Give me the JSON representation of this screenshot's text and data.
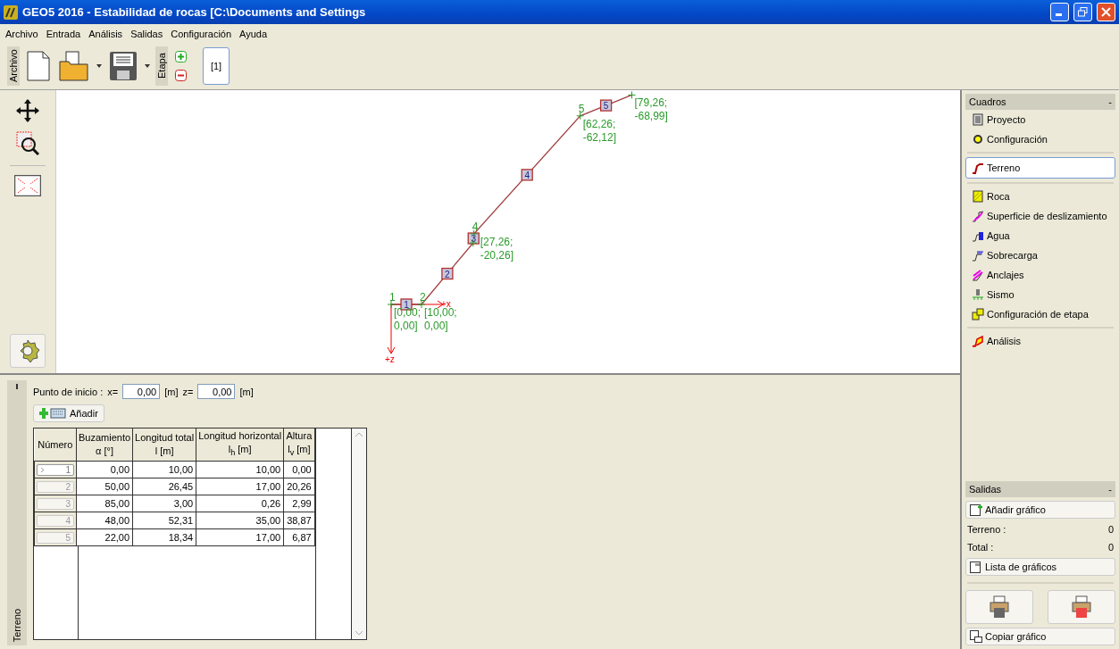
{
  "window": {
    "title": "GEO5 2016 - Estabilidad de rocas [C:\\Documents and Settings"
  },
  "menu": [
    "Archivo",
    "Entrada",
    "Análisis",
    "Salidas",
    "Configuración",
    "Ayuda"
  ],
  "toolbar": {
    "group_label": "Archivo",
    "stage_label": "Etapa",
    "stages": [
      {
        "label": "[1]",
        "selected": true
      }
    ]
  },
  "canvas": {
    "axis_x": "+x",
    "axis_z": "+z",
    "segments": [
      {
        "label": "1"
      },
      {
        "label": "2"
      },
      {
        "label": "3"
      },
      {
        "label": "4"
      },
      {
        "label": "5"
      }
    ],
    "points": [
      {
        "kind": "labelled",
        "number": "1",
        "coords": [
          "[0,00;",
          "0,00]"
        ]
      },
      {
        "kind": "labelled",
        "number": "2",
        "coords": [
          "[10,00;",
          "0,00]"
        ]
      },
      {
        "kind": "bare"
      },
      {
        "kind": "labelled",
        "number": "4",
        "coords": [
          "[27,26;",
          "-20,26]"
        ]
      },
      {
        "kind": "labelled",
        "number": "5",
        "coords": [
          "[62,26;",
          "-62,12]"
        ]
      },
      {
        "kind": "labelled",
        "coords": [
          "[79,26;",
          "-68,99]"
        ]
      }
    ]
  },
  "input": {
    "label": "Punto de inicio :",
    "x_label": "x=",
    "x_value": "0,00",
    "x_unit": "[m]",
    "z_label": "z=",
    "z_value": "0,00",
    "z_unit": "[m]",
    "add_button": "Añadir",
    "tab_label": "Terreno"
  },
  "table": {
    "columns": [
      {
        "title": "Número"
      },
      {
        "title": "Buzamiento",
        "unit": "α [°]"
      },
      {
        "title": "Longitud total",
        "unit": "l [m]"
      },
      {
        "title": "Longitud horizontal",
        "unit": "l$_{h}$ [m]"
      },
      {
        "title": "Altura",
        "unit": "l$_{v}$ [m]"
      }
    ],
    "rows": [
      {
        "selected": true,
        "cells": [
          "1",
          "0,00",
          "10,00",
          "10,00",
          "0,00"
        ]
      },
      {
        "selected": false,
        "cells": [
          "2",
          "50,00",
          "26,45",
          "17,00",
          "20,26"
        ]
      },
      {
        "selected": false,
        "cells": [
          "3",
          "85,00",
          "3,00",
          "0,26",
          "2,99"
        ]
      },
      {
        "selected": false,
        "cells": [
          "4",
          "48,00",
          "52,31",
          "35,00",
          "38,87"
        ]
      },
      {
        "selected": false,
        "cells": [
          "5",
          "22,00",
          "18,34",
          "17,00",
          "6,87"
        ]
      }
    ]
  },
  "frames": {
    "title": "Cuadros",
    "collapse": "-",
    "items": [
      {
        "label": "Proyecto",
        "selected": false,
        "divider_before": false
      },
      {
        "label": "Configuración",
        "selected": false,
        "divider_before": false
      },
      {
        "label": "Terreno",
        "selected": true,
        "divider_before": true
      },
      {
        "label": "Roca",
        "selected": false,
        "divider_before": true
      },
      {
        "label": "Superficie de deslizamiento",
        "selected": false,
        "divider_before": false
      },
      {
        "label": "Agua",
        "selected": false,
        "divider_before": false
      },
      {
        "label": "Sobrecarga",
        "selected": false,
        "divider_before": false
      },
      {
        "label": "Anclajes",
        "selected": false,
        "divider_before": false
      },
      {
        "label": "Sismo",
        "selected": false,
        "divider_before": false
      },
      {
        "label": "Configuración de etapa",
        "selected": false,
        "divider_before": false
      },
      {
        "label": "Análisis",
        "selected": false,
        "divider_before": true
      }
    ]
  },
  "outputs": {
    "title": "Salidas",
    "collapse": "-",
    "add_button": "Añadir gráfico",
    "counts": [
      {
        "label": "Terreno :",
        "value": "0"
      },
      {
        "label": "Total :",
        "value": "0"
      }
    ],
    "list_button": "Lista de gráficos",
    "copy_button": "Copiar gráfico"
  }
}
